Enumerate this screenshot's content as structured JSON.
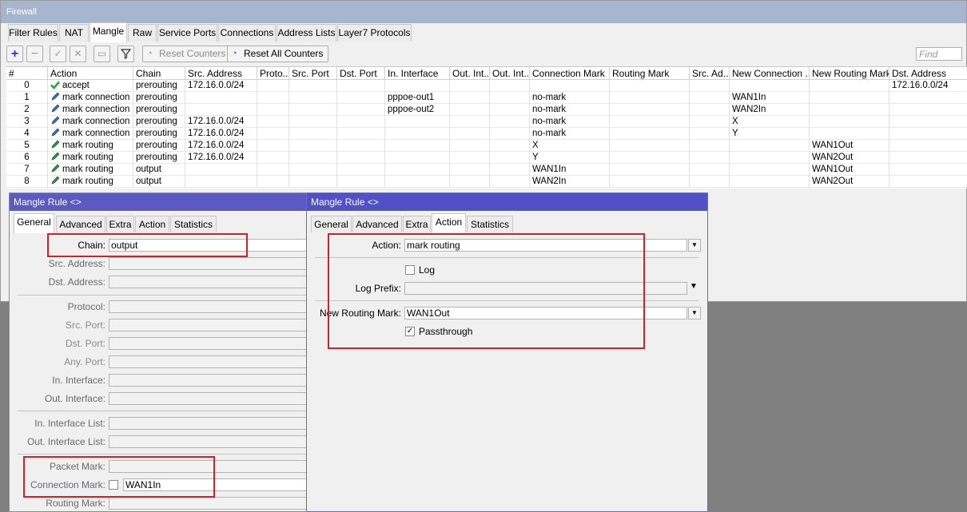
{
  "firewall": {
    "title": "Firewall",
    "tabs": [
      "Filter Rules",
      "NAT",
      "Mangle",
      "Raw",
      "Service Ports",
      "Connections",
      "Address Lists",
      "Layer7 Protocols"
    ],
    "active_tab": "Mangle",
    "toolbar": {
      "reset_counters": "Reset Counters",
      "reset_all_counters": "Reset All Counters",
      "find_placeholder": "Find"
    },
    "columns": [
      "#",
      "Action",
      "Chain",
      "Src. Address",
      "Proto...",
      "Src. Port",
      "Dst. Port",
      "In. Interface",
      "Out. Int...",
      "Out. Int...",
      "Connection Mark",
      "Routing Mark",
      "Src. Ad...",
      "New Connection ...",
      "New Routing Mark",
      "Dst. Address"
    ],
    "rows": [
      {
        "num": "0",
        "action": "accept",
        "icon": "check-icon",
        "chain": "prerouting",
        "src": "172.16.0.0/24",
        "in_if": "",
        "conn_mark": "",
        "new_conn": "",
        "new_route": "",
        "dst": "172.16.0.0/24"
      },
      {
        "num": "1",
        "action": "mark connection",
        "icon": "pencil-icon",
        "chain": "prerouting",
        "src": "",
        "in_if": "pppoe-out1",
        "conn_mark": "no-mark",
        "new_conn": "WAN1In",
        "new_route": "",
        "dst": ""
      },
      {
        "num": "2",
        "action": "mark connection",
        "icon": "pencil-icon",
        "chain": "prerouting",
        "src": "",
        "in_if": "pppoe-out2",
        "conn_mark": "no-mark",
        "new_conn": "WAN2In",
        "new_route": "",
        "dst": ""
      },
      {
        "num": "3",
        "action": "mark connection",
        "icon": "pencil-icon",
        "chain": "prerouting",
        "src": "172.16.0.0/24",
        "in_if": "",
        "conn_mark": "no-mark",
        "new_conn": "X",
        "new_route": "",
        "dst": ""
      },
      {
        "num": "4",
        "action": "mark connection",
        "icon": "pencil-icon",
        "chain": "prerouting",
        "src": "172.16.0.0/24",
        "in_if": "",
        "conn_mark": "no-mark",
        "new_conn": "Y",
        "new_route": "",
        "dst": ""
      },
      {
        "num": "5",
        "action": "mark routing",
        "icon": "green-pencil-icon",
        "chain": "prerouting",
        "src": "172.16.0.0/24",
        "in_if": "",
        "conn_mark": "X",
        "new_conn": "",
        "new_route": "WAN1Out",
        "dst": ""
      },
      {
        "num": "6",
        "action": "mark routing",
        "icon": "green-pencil-icon",
        "chain": "prerouting",
        "src": "172.16.0.0/24",
        "in_if": "",
        "conn_mark": "Y",
        "new_conn": "",
        "new_route": "WAN2Out",
        "dst": ""
      },
      {
        "num": "7",
        "action": "mark routing",
        "icon": "green-pencil-icon",
        "chain": "output",
        "src": "",
        "in_if": "",
        "conn_mark": "WAN1In",
        "new_conn": "",
        "new_route": "WAN1Out",
        "dst": ""
      },
      {
        "num": "8",
        "action": "mark routing",
        "icon": "green-pencil-icon",
        "chain": "output",
        "src": "",
        "in_if": "",
        "conn_mark": "WAN2In",
        "new_conn": "",
        "new_route": "WAN2Out",
        "dst": ""
      }
    ]
  },
  "rule_general": {
    "title": "Mangle Rule <>",
    "tabs": [
      "General",
      "Advanced",
      "Extra",
      "Action",
      "Statistics"
    ],
    "active_tab": "General",
    "labels": {
      "chain": "Chain:",
      "src_address": "Src. Address:",
      "dst_address": "Dst. Address:",
      "protocol": "Protocol:",
      "src_port": "Src. Port:",
      "dst_port": "Dst. Port:",
      "any_port": "Any. Port:",
      "in_interface": "In. Interface:",
      "out_interface": "Out. Interface:",
      "in_interface_list": "In. Interface List:",
      "out_interface_list": "Out. Interface List:",
      "packet_mark": "Packet Mark:",
      "connection_mark": "Connection Mark:",
      "routing_mark": "Routing Mark:"
    },
    "values": {
      "chain": "output",
      "connection_mark": "WAN1In"
    }
  },
  "rule_action": {
    "title": "Mangle Rule <>",
    "tabs": [
      "General",
      "Advanced",
      "Extra",
      "Action",
      "Statistics"
    ],
    "active_tab": "Action",
    "labels": {
      "action": "Action:",
      "log": "Log",
      "log_prefix": "Log Prefix:",
      "new_routing_mark": "New Routing Mark:",
      "passthrough": "Passthrough"
    },
    "values": {
      "action": "mark routing",
      "log_checked": false,
      "new_routing_mark": "WAN1Out",
      "passthrough_checked": true
    }
  },
  "colors": {
    "title_active": "#5050c8",
    "title_inactive": "#a7b6cf",
    "highlight_box": "#d0222d",
    "accept_icon": "#22a832",
    "mark_connection_icon": "#3a6fc8",
    "mark_routing_icon": "#2aa02a"
  }
}
